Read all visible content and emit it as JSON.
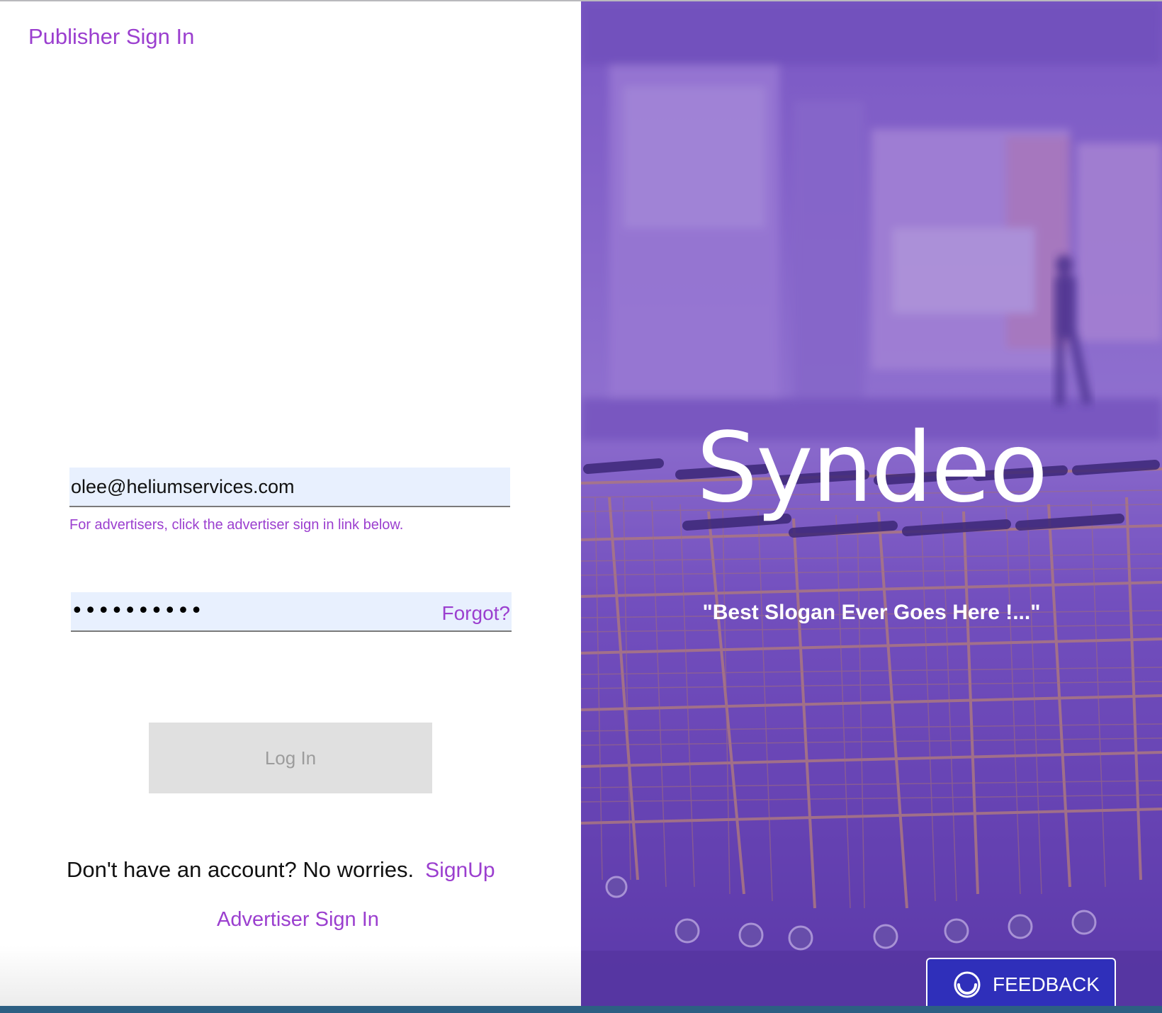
{
  "left_panel": {
    "title": "Publisher Sign In",
    "email": {
      "value": "olee@heliumservices.com",
      "hint": "For advertisers, click the advertiser sign in link below."
    },
    "password": {
      "masked_value": "••••••••••",
      "forgot_label": "Forgot?"
    },
    "login_button_label": "Log In",
    "signup_prompt": "Don't have an account? No worries.",
    "signup_link": "SignUp",
    "advertiser_link": "Advertiser Sign In"
  },
  "right_panel": {
    "brand": "Syndeo",
    "slogan": "\"Best Slogan Ever Goes Here !...\"",
    "feedback_label": "FEEDBACK",
    "feedback_icon": "feedback-smile-icon"
  },
  "colors": {
    "accent_purple": "#9b3fcf",
    "hero_overlay": "#6a42b4",
    "input_fill": "#e8f0fe",
    "feedback_blue": "#2f2fba"
  }
}
